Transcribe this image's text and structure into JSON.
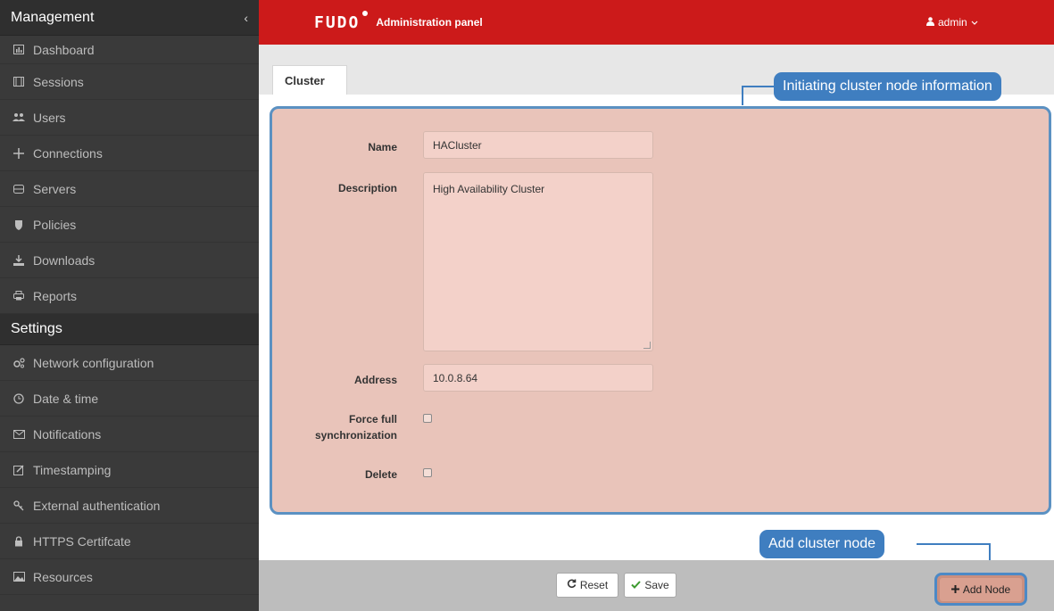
{
  "sidebar": {
    "management_title": "Management",
    "collapse_icon": "‹",
    "management_items": [
      {
        "label": "Dashboard",
        "icon": "dashboard-icon"
      },
      {
        "label": "Sessions",
        "icon": "film-icon"
      },
      {
        "label": "Users",
        "icon": "users-icon"
      },
      {
        "label": "Connections",
        "icon": "connections-icon"
      },
      {
        "label": "Servers",
        "icon": "server-icon"
      },
      {
        "label": "Policies",
        "icon": "shield-icon"
      },
      {
        "label": "Downloads",
        "icon": "download-icon"
      },
      {
        "label": "Reports",
        "icon": "printer-icon"
      }
    ],
    "settings_title": "Settings",
    "settings_items": [
      {
        "label": "Network configuration",
        "icon": "gears-icon"
      },
      {
        "label": "Date & time",
        "icon": "clock-icon"
      },
      {
        "label": "Notifications",
        "icon": "envelope-icon"
      },
      {
        "label": "Timestamping",
        "icon": "edit-icon"
      },
      {
        "label": "External authentication",
        "icon": "key-icon"
      },
      {
        "label": "HTTPS Certifcate",
        "icon": "lock-icon"
      },
      {
        "label": "Resources",
        "icon": "image-icon"
      }
    ]
  },
  "header": {
    "logo": "FUDO",
    "title": "Administration panel",
    "user": "admin"
  },
  "tabs": [
    {
      "label": "Cluster"
    }
  ],
  "form": {
    "name_label": "Name",
    "name_value": "HACluster",
    "description_label": "Description",
    "description_value": "High Availability Cluster",
    "address_label": "Address",
    "address_value": "10.0.8.64",
    "force_sync_label_line1": "Force full",
    "force_sync_label_line2": "synchronization",
    "force_sync_checked": false,
    "delete_label": "Delete",
    "delete_checked": false
  },
  "callouts": {
    "node_info": "Initiating cluster node information",
    "add_node": "Add cluster node"
  },
  "footer": {
    "reset_label": "Reset",
    "save_label": "Save",
    "add_node_label": "Add Node"
  },
  "colors": {
    "header_red": "#cc1a1a",
    "sidebar_dark": "#3a3a3a",
    "callout_blue": "#3f7ec0",
    "panel_highlight": "#e9c4ba",
    "save_check_green": "#3c9a2f"
  }
}
